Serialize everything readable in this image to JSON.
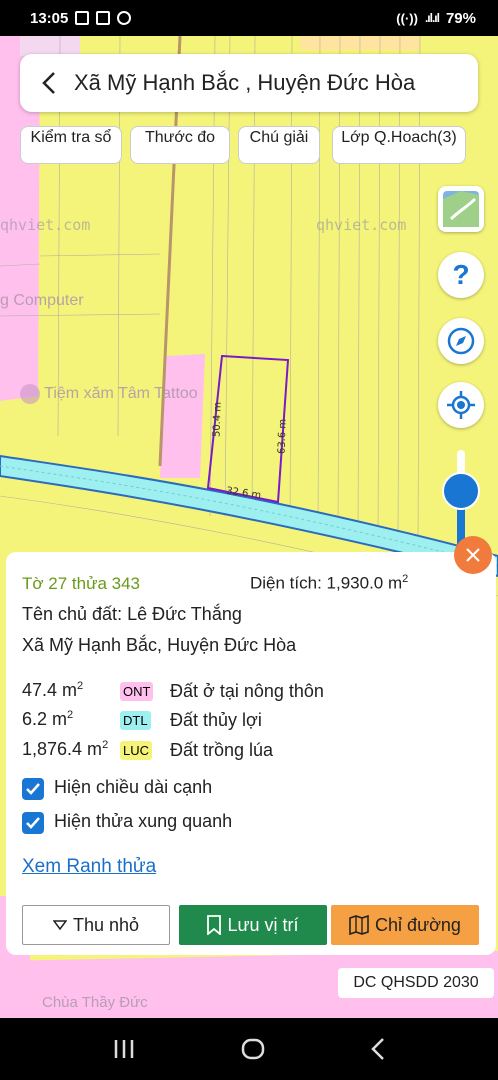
{
  "status_bar": {
    "left_text": "13:05",
    "right_text": "79%"
  },
  "header": {
    "title": "Xã Mỹ Hạnh Bắc , Huyện Đức Hòa"
  },
  "toolbar": {
    "check_book": "Kiểm tra sổ",
    "ruler": "Thước đo",
    "legend": "Chú giải",
    "layer": "Lớp Q.Hoach(3)"
  },
  "map": {
    "watermark": "qhviet.com",
    "poi_computer": "g Computer",
    "poi_tattoo": "Tiệm xăm Tâm Tattoo",
    "poi_pagoda": "Chùa Thầy Đức",
    "edge_left": "50.4 m",
    "edge_right": "63.6 m",
    "edge_bottom": "32.6 m",
    "colors": {
      "farmland": "#f4f47a",
      "residential": "#ffc0ee",
      "river": "#9eeff0",
      "parcel_outline": "#7a1ac9",
      "road": "#b8956a"
    }
  },
  "parcel": {
    "id": "Tờ 27 thửa 343",
    "area_label": "Diện tích: 1,930.0 m",
    "area_unit_sup": "2",
    "owner": "Tên chủ đất: Lê Đức Thắng",
    "address": "Xã Mỹ Hạnh Bắc, Huyện Đức Hòa",
    "land_uses": [
      {
        "area": "47.4 m",
        "sup": "2",
        "code": "ONT",
        "desc": "Đất ở tại nông thôn",
        "color": "#ffc0ee"
      },
      {
        "area": "6.2 m",
        "sup": "2",
        "code": "DTL",
        "desc": "Đất thủy lợi",
        "color": "#9eeff0"
      },
      {
        "area": "1,876.4 m",
        "sup": "2",
        "code": "LUC",
        "desc": "Đất trồng lúa",
        "color": "#f4f47a"
      }
    ],
    "show_edges": "Hiện chiều dài cạnh",
    "show_neighbors": "Hiện thửa xung quanh",
    "boundary_link": "Xem Ranh thửa"
  },
  "actions": {
    "collapse": "Thu nhỏ",
    "save": "Lưu vị trí",
    "route": "Chỉ đường"
  },
  "plan_badge": "DC QHSDD 2030"
}
